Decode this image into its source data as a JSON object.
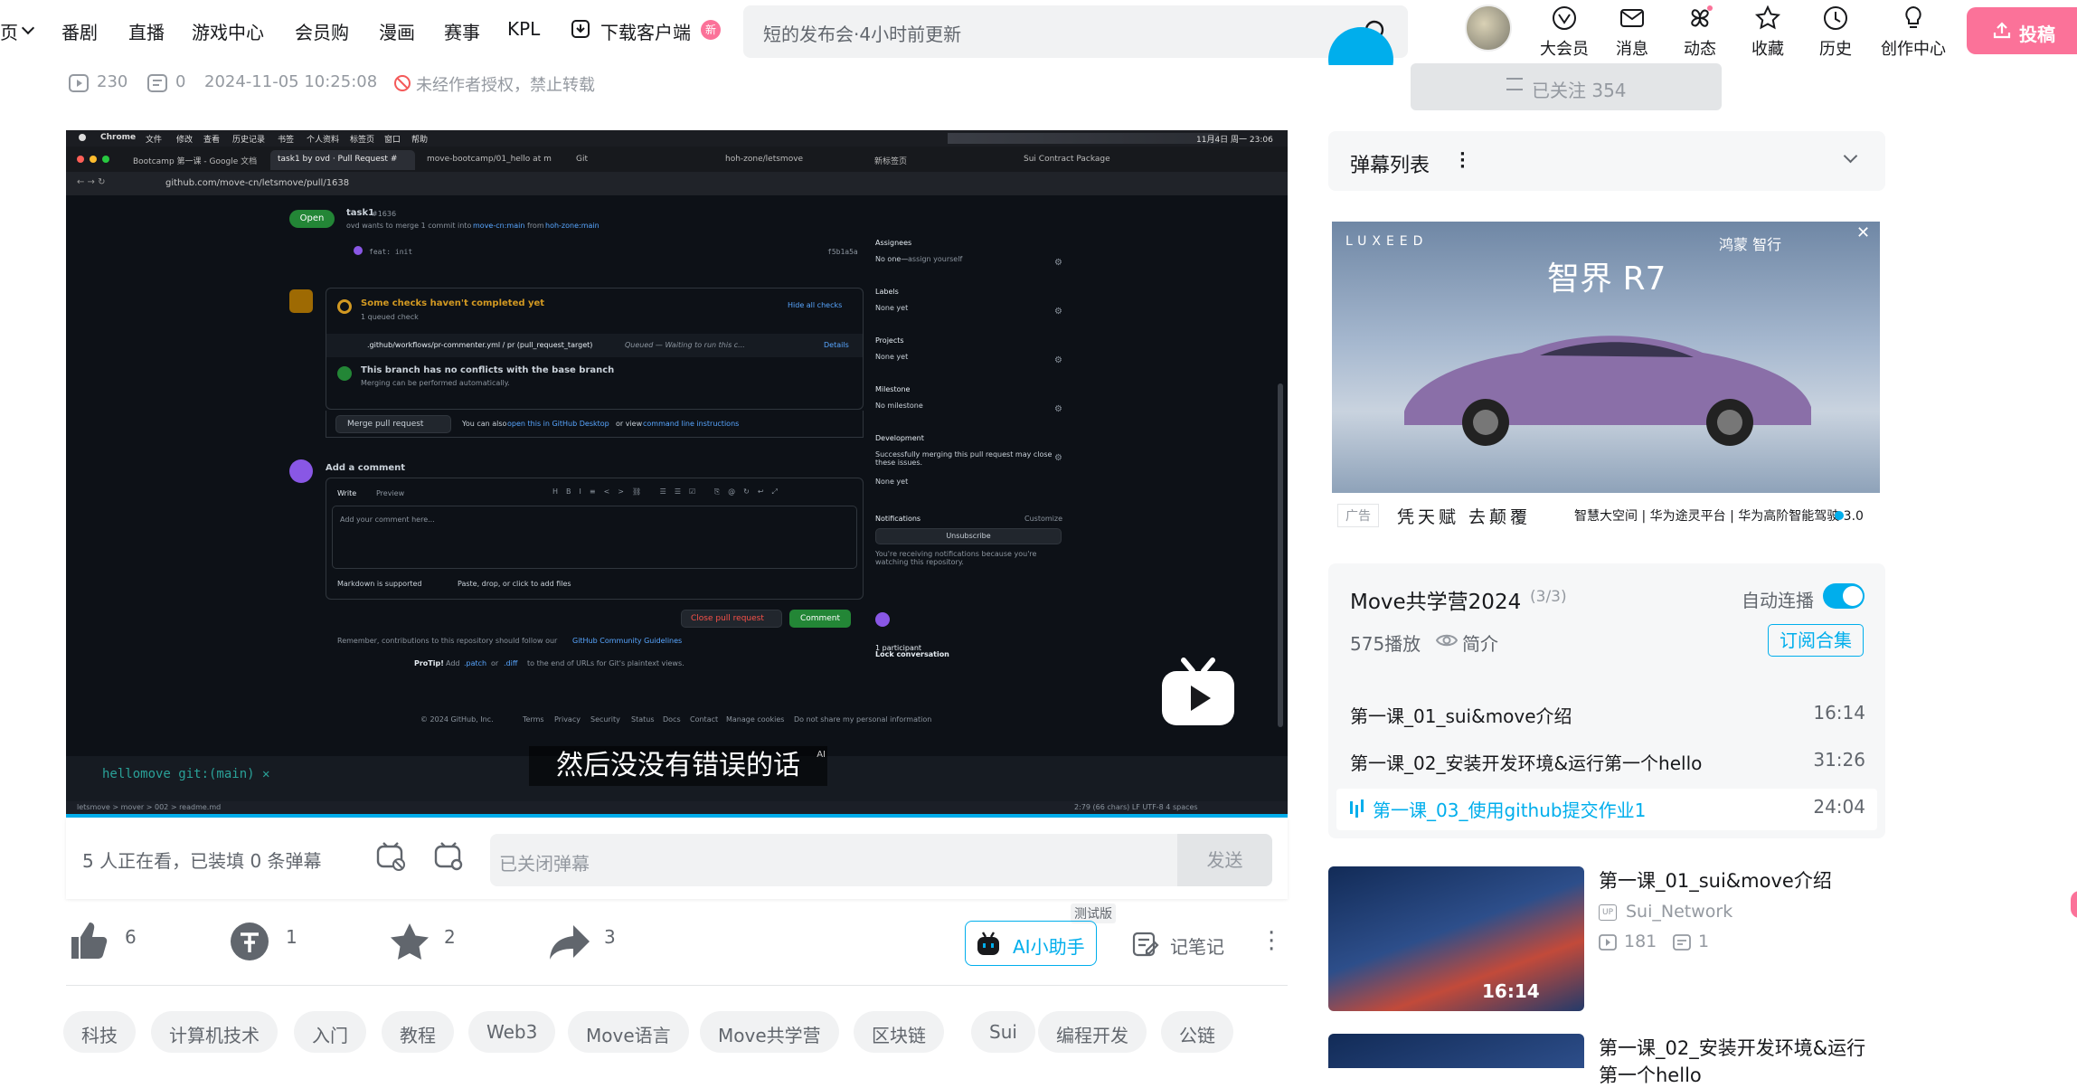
{
  "nav": {
    "items": [
      "页",
      "番剧",
      "直播",
      "游戏中心",
      "会员购",
      "漫画",
      "赛事",
      "KPL"
    ],
    "download": "下载客户端",
    "new_badge": "新",
    "search_placeholder": "短的发布会·4小时前更新",
    "header_buttons": [
      "大会员",
      "消息",
      "动态",
      "收藏",
      "历史",
      "创作中心"
    ],
    "upload": "投稿"
  },
  "meta": {
    "views": "230",
    "danmaku": "0",
    "date": "2024-11-05 10:25:08",
    "copyright": "未经作者授权，禁止转载"
  },
  "follow": {
    "label": "已关注 354"
  },
  "player": {
    "mac_menu": [
      "Chrome",
      "文件",
      "修改",
      "查看",
      "历史记录",
      "书签",
      "个人资料",
      "标签页",
      "窗口",
      "帮助"
    ],
    "mac_time": "11月4日 周一 23:06",
    "tabs": [
      "Bootcamp 第一课 - Google 文档",
      "task1 by ovd · Pull Request #",
      "move-bootcamp/01_hello at m",
      "Git",
      "hoh-zone/letsmove",
      "新标签页",
      "Sui Contract Package"
    ],
    "url": "github.com/move-cn/letsmove/pull/1638",
    "pr_badge": "Open",
    "pr_title": "task1",
    "pr_number": "#1636",
    "pr_sub_1": "ovd wants to merge 1 commit into",
    "pr_base": "move-cn:main",
    "pr_sub_2": "from",
    "pr_head": "hoh-zone:main",
    "commit_msg": "feat: init",
    "commit_hash": "f5b1a5a",
    "checks_title": "Some checks haven't completed yet",
    "checks_sub": "1 queued check",
    "hide_checks": "Hide all checks",
    "check_job": ".github/workflows/pr-commenter.yml / pr (pull_request_target)",
    "check_status": "Queued — Waiting to run this c...",
    "check_details": "Details",
    "no_conflicts": "This branch has no conflicts with the base branch",
    "no_conflicts_sub": "Merging can be performed automatically.",
    "merge_btn": "Merge pull request",
    "merge_note_1": "You can also",
    "merge_note_link1": "open this in GitHub Desktop",
    "merge_note_2": "or view",
    "merge_note_link2": "command line instructions",
    "add_comment": "Add a comment",
    "write_tab": "Write",
    "preview_tab": "Preview",
    "comment_placeholder": "Add your comment here...",
    "markdown_note": "Markdown is supported",
    "paste_note": "Paste, drop, or click to add files",
    "close_pr": "Close pull request",
    "comment_btn": "Comment",
    "remember_1": "Remember, contributions to this repository should follow our",
    "remember_link": "GitHub Community Guidelines",
    "protip_1": "ProTip!",
    "protip_2": "Add",
    "protip_link1": ".patch",
    "protip_3": "or",
    "protip_link2": ".diff",
    "protip_4": "to the end of URLs for Git's plaintext views.",
    "footer": [
      "© 2024 GitHub, Inc.",
      "Terms",
      "Privacy",
      "Security",
      "Status",
      "Docs",
      "Contact",
      "Manage cookies",
      "Do not share my personal information"
    ],
    "sidebar": [
      {
        "title": "Assignees",
        "value": "No one—",
        "link": "assign yourself"
      },
      {
        "title": "Labels",
        "value": "None yet"
      },
      {
        "title": "Projects",
        "value": "None yet"
      },
      {
        "title": "Milestone",
        "value": "No milestone"
      },
      {
        "title": "Development",
        "value": "Successfully merging this pull request may close these issues.",
        "value2": "None yet"
      }
    ],
    "notifications": "Notifications",
    "customize": "Customize",
    "unsubscribe": "Unsubscribe",
    "notif_note": "You're receiving notifications because you're watching this repository.",
    "participants": "1 participant",
    "lock": "Lock conversation",
    "terminal": "hellomove git:(main) ✕",
    "status_left": "letsmove  >  mover  >  002  >  readme.md",
    "status_right": "2:79 (66 chars)   LF   UTF-8   4 spaces",
    "subtitle": "然后没没有错误的话",
    "subtitle_ai": "AI"
  },
  "danmaku_bar": {
    "watching": "5 人正在看，已装填 0 条弹幕",
    "input_placeholder": "已关闭弹幕",
    "send": "发送"
  },
  "actions": {
    "like": "6",
    "coin": "1",
    "fav": "2",
    "share": "3",
    "ai_badge": "测试版",
    "ai": "AI小助手",
    "notes": "记笔记"
  },
  "tags": [
    "科技",
    "计算机技术",
    "入门",
    "教程",
    "Web3",
    "Move语言",
    "Move共学营",
    "区块链",
    "Sui",
    "编程开发",
    "公链"
  ],
  "danmaku_list": {
    "title": "弹幕列表"
  },
  "ad": {
    "brand": "LUXEED",
    "partner": "鸿蒙 智行",
    "model": "智界 R7",
    "label": "广告",
    "slogan": "凭天赋  去颠覆",
    "desc": "智慧大空间 | 华为途灵平台 | 华为高阶智能驾驶 3.0"
  },
  "collection": {
    "title": "Move共学营2024",
    "count": "(3/3)",
    "autoplay": "自动连播",
    "plays": "575播放",
    "intro": "简介",
    "subscribe": "订阅合集",
    "episodes": [
      {
        "title": "第一课_01_sui&move介绍",
        "duration": "16:14"
      },
      {
        "title": "第一课_02_安装开发环境&运行第一个hello",
        "duration": "31:26"
      },
      {
        "title": "第一课_03_使用github提交作业1",
        "duration": "24:04"
      }
    ]
  },
  "recommendations": [
    {
      "title": "第一课_01_sui&move介绍",
      "up": "Sui_Network",
      "views": "181",
      "danmaku": "1",
      "duration": "16:14"
    },
    {
      "title": "第一课_02_安装开发环境&运行第一个hello",
      "title_line2": "行第一个hello"
    }
  ],
  "colors": {
    "brand_pink": "#fb7299",
    "brand_blue": "#00aeec",
    "gh_green": "#238636"
  }
}
